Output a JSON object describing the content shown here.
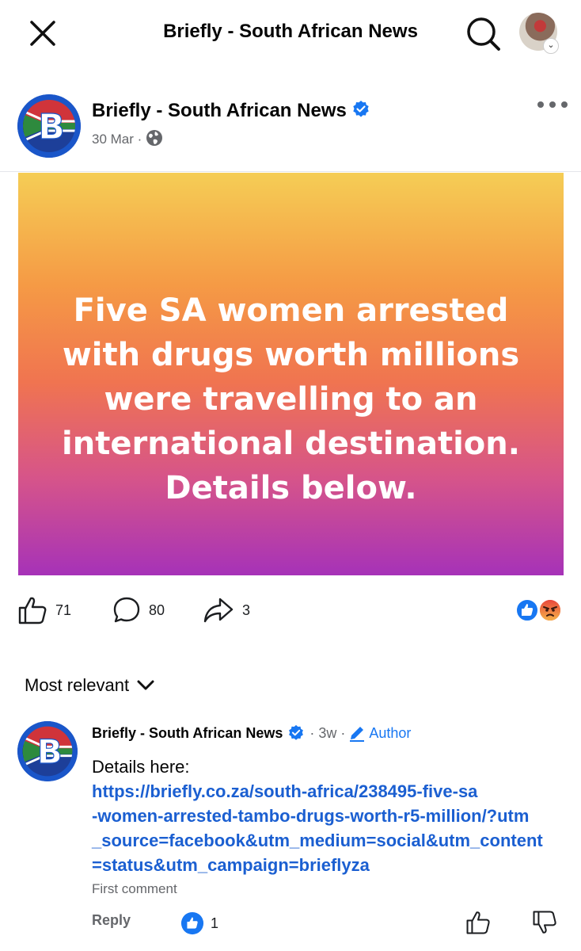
{
  "header": {
    "title": "Briefly - South African News",
    "close_icon": "close-icon",
    "search_icon": "search-icon"
  },
  "post": {
    "author": "Briefly - South African News",
    "date": "30 Mar",
    "date_sep": "·",
    "banner_text": "Five SA women arrested with drugs worth millions were travelling to an international destination. Details below.",
    "banner_colors": [
      "#f5cd55",
      "#f07450",
      "#a632b8"
    ],
    "likes": "71",
    "comments": "80",
    "shares": "3",
    "reactions": [
      "like-reaction-icon",
      "angry-reaction-icon"
    ]
  },
  "sort": {
    "label": "Most relevant"
  },
  "comment": {
    "author": "Briefly - South African News",
    "time": "· 3w ·",
    "badge": "Author",
    "text": "Details here:",
    "link": "https://briefly.co.za/south-africa/238495-five-sa-women-arrested-tambo-drugs-worth-r5-million/?utm_source=facebook&utm_medium=social&utm_content=status&utm_campaign=brieflyza",
    "link_lines": [
      "https://briefly.co.za/south-africa/238495-five-sa",
      "-women-arrested-tambo-drugs-worth-r5-million/?utm",
      "_source=facebook&utm_medium=social&utm_content",
      "=status&utm_campaign=brieflyza"
    ],
    "meta": "First comment",
    "reply": "Reply",
    "likes": "1"
  },
  "colors": {
    "accent": "#1877f2",
    "link": "#1b5fd1",
    "secondary_text": "#65676b"
  }
}
